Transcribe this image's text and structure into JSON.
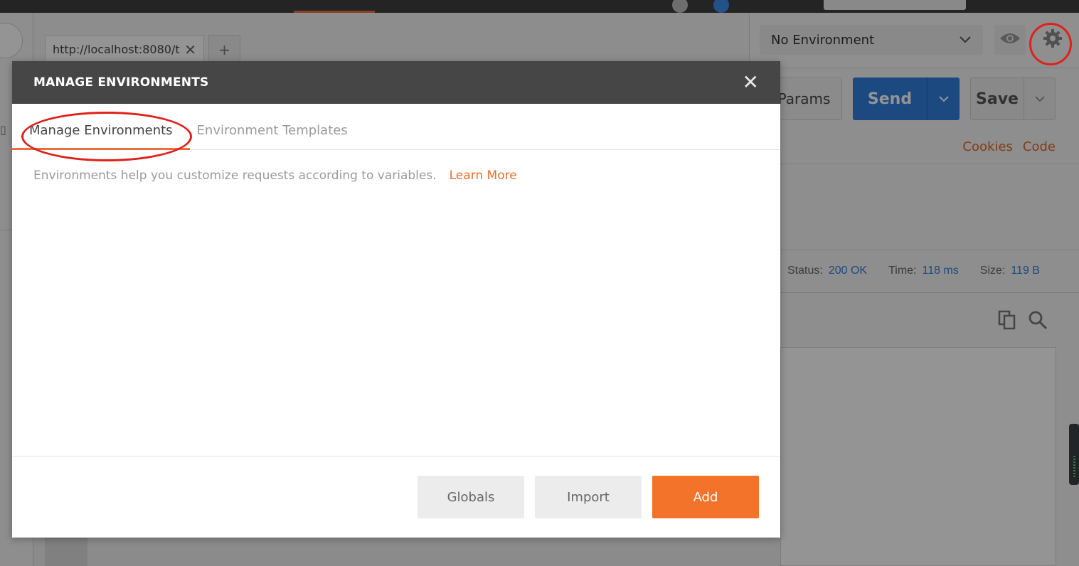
{
  "app": {
    "request_tab": {
      "url": "http://localhost:8080/t",
      "close": "✕"
    },
    "new_tab": "+",
    "environment": {
      "selected": "No Environment"
    },
    "request": {
      "params_label": "Params",
      "send_label": "Send",
      "save_label": "Save",
      "cookies_link": "Cookies",
      "code_link": "Code"
    },
    "response": {
      "status_label": "Status:",
      "status_value": "200 OK",
      "time_label": "Time:",
      "time_value": "118 ms",
      "size_label": "Size:",
      "size_value": "119 B"
    }
  },
  "modal": {
    "title": "MANAGE ENVIRONMENTS",
    "close": "✕",
    "tabs": [
      {
        "label": "Manage Environments",
        "active": true
      },
      {
        "label": "Environment Templates",
        "active": false
      }
    ],
    "intro_text": "Environments help you customize requests according to variables.",
    "learn_more": "Learn More",
    "buttons": {
      "globals": "Globals",
      "import": "Import",
      "add": "Add"
    }
  },
  "colors": {
    "accent": "#f26b3a",
    "send_blue": "#2f7fdc",
    "annotation_red": "#e0211a",
    "header_dark": "#464646"
  },
  "icons": [
    "eye-icon",
    "gear-icon",
    "copy-icon",
    "search-icon",
    "chevron-down-icon",
    "close-icon",
    "plus-icon"
  ]
}
